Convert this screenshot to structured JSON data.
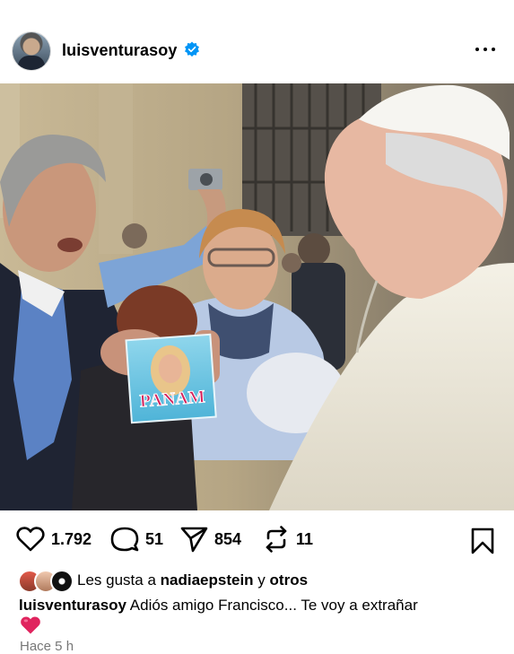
{
  "post": {
    "username": "luisventurasoy",
    "image_alt": "Photo with Pope Francis",
    "actions": {
      "likes": "1.792",
      "comments": "51",
      "shares": "854",
      "reposts": "11"
    },
    "liked_by": {
      "prefix": "Les gusta a",
      "user": "nadiaepstein",
      "joiner": "y",
      "others": "otros"
    },
    "caption": {
      "username": "luisventurasoy",
      "text": "Adiós amigo Francisco... Te voy a extrañar",
      "emoji": "heart-emoji"
    },
    "date": "Hace 5 h"
  },
  "colors": {
    "verified": "#0095f6",
    "text": "#000000",
    "secondary": "#737373",
    "heart_emoji": "#e0245e"
  },
  "photo_text": {
    "cd_title": "PANAM"
  }
}
